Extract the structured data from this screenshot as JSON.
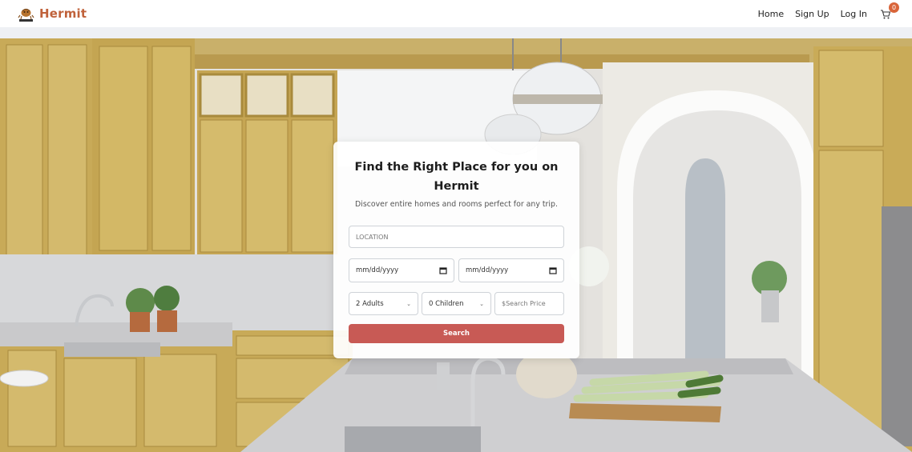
{
  "brand": {
    "name": "Hermit",
    "logo_icon": "hermit-crab-logo-icon",
    "color": "#c0623b"
  },
  "nav": {
    "links": [
      "Home",
      "Sign Up",
      "Log In"
    ],
    "cart_count": "0",
    "cart_icon": "cart-icon"
  },
  "card": {
    "title": "Find the Right Place for you on Hermit",
    "subtitle": "Discover entire homes and rooms perfect for any trip.",
    "location_placeholder": "LOCATION",
    "checkin_placeholder": "mm/dd/yyyy",
    "checkout_placeholder": "mm/dd/yyyy",
    "adults_value": "2 Adults",
    "children_value": "0 Children",
    "price_placeholder": "$Search Price",
    "search_label": "Search",
    "button_color": "#c85a55"
  }
}
